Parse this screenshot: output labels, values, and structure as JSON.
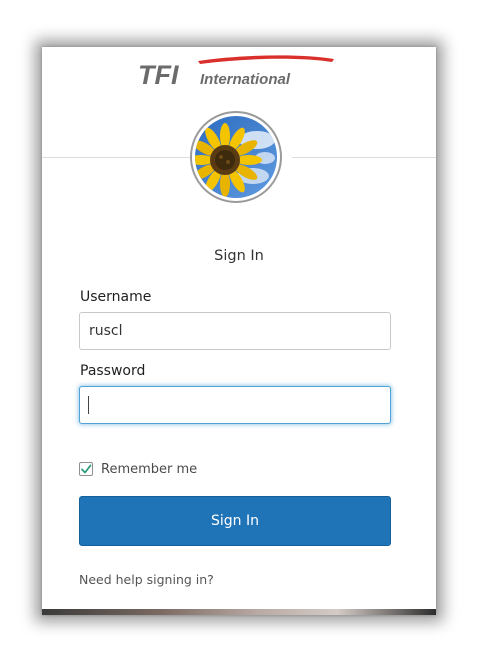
{
  "brand": {
    "logo_text_primary": "TFI",
    "logo_text_secondary": "International",
    "logo_colors": {
      "primary": "#6b6b6b",
      "swoosh": "#d9302b"
    }
  },
  "avatar": {
    "icon": "sunflower-icon"
  },
  "form": {
    "heading": "Sign In",
    "username_label": "Username",
    "username_value": "ruscl",
    "password_label": "Password",
    "password_value": "",
    "remember_label": "Remember me",
    "remember_checked": true,
    "submit_label": "Sign In",
    "help_link": "Need help signing in?"
  },
  "colors": {
    "button": "#1f73b7",
    "focus_border": "#4fa3d6",
    "checkmark": "#2c9a7a"
  }
}
